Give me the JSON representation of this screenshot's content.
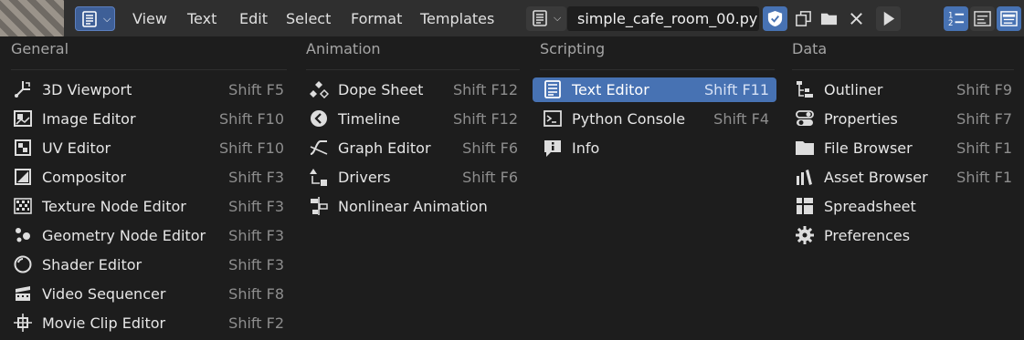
{
  "header": {
    "menus": [
      "View",
      "Text",
      "Edit",
      "Select",
      "Format",
      "Templates"
    ],
    "filename": "simple_cafe_room_00.py"
  },
  "columns": [
    {
      "title": "General",
      "items": [
        {
          "label": "3D Viewport",
          "shortcut": "Shift F5",
          "icon": "viewport-3d-icon"
        },
        {
          "label": "Image Editor",
          "shortcut": "Shift F10",
          "icon": "image-editor-icon"
        },
        {
          "label": "UV Editor",
          "shortcut": "Shift F10",
          "icon": "uv-editor-icon"
        },
        {
          "label": "Compositor",
          "shortcut": "Shift F3",
          "icon": "compositor-icon"
        },
        {
          "label": "Texture Node Editor",
          "shortcut": "Shift F3",
          "icon": "texture-node-icon"
        },
        {
          "label": "Geometry Node Editor",
          "shortcut": "Shift F3",
          "icon": "geometry-node-icon"
        },
        {
          "label": "Shader Editor",
          "shortcut": "Shift F3",
          "icon": "shader-editor-icon"
        },
        {
          "label": "Video Sequencer",
          "shortcut": "Shift F8",
          "icon": "video-sequencer-icon"
        },
        {
          "label": "Movie Clip Editor",
          "shortcut": "Shift F2",
          "icon": "movie-clip-icon"
        }
      ]
    },
    {
      "title": "Animation",
      "items": [
        {
          "label": "Dope Sheet",
          "shortcut": "Shift F12",
          "icon": "dope-sheet-icon"
        },
        {
          "label": "Timeline",
          "shortcut": "Shift F12",
          "icon": "timeline-icon"
        },
        {
          "label": "Graph Editor",
          "shortcut": "Shift F6",
          "icon": "graph-editor-icon"
        },
        {
          "label": "Drivers",
          "shortcut": "Shift F6",
          "icon": "drivers-icon"
        },
        {
          "label": "Nonlinear Animation",
          "shortcut": "",
          "icon": "nla-icon"
        }
      ]
    },
    {
      "title": "Scripting",
      "items": [
        {
          "label": "Text Editor",
          "shortcut": "Shift F11",
          "icon": "text-editor-icon",
          "active": true
        },
        {
          "label": "Python Console",
          "shortcut": "Shift F4",
          "icon": "python-console-icon"
        },
        {
          "label": "Info",
          "shortcut": "",
          "icon": "info-icon"
        }
      ]
    },
    {
      "title": "Data",
      "items": [
        {
          "label": "Outliner",
          "shortcut": "Shift F9",
          "icon": "outliner-icon"
        },
        {
          "label": "Properties",
          "shortcut": "Shift F7",
          "icon": "properties-icon"
        },
        {
          "label": "File Browser",
          "shortcut": "Shift F1",
          "icon": "file-browser-icon"
        },
        {
          "label": "Asset Browser",
          "shortcut": "Shift F1",
          "icon": "asset-browser-icon"
        },
        {
          "label": "Spreadsheet",
          "shortcut": "",
          "icon": "spreadsheet-icon"
        },
        {
          "label": "Preferences",
          "shortcut": "",
          "icon": "preferences-icon"
        }
      ]
    }
  ],
  "colors": {
    "accent": "#4772b3",
    "background": "#1d1d1d",
    "header": "#2f2f2f"
  }
}
